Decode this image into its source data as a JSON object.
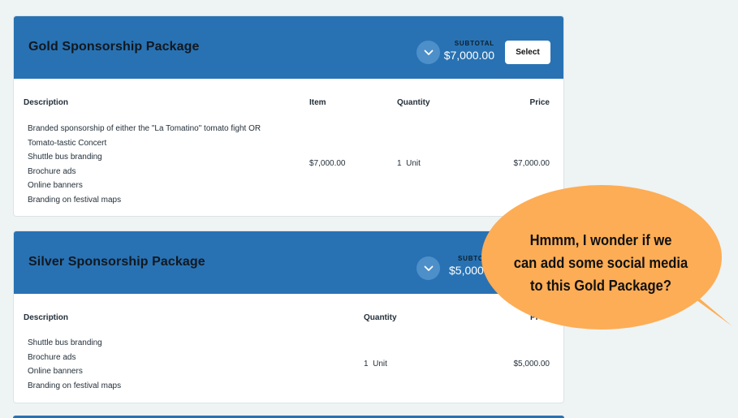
{
  "packages": [
    {
      "title": "Gold Sponsorship Package",
      "subtotal_label": "SUBTOTAL",
      "subtotal": "$7,000.00",
      "select_label": "Select",
      "headers": {
        "description": "Description",
        "item": "Item",
        "quantity": "Quantity",
        "price": "Price"
      },
      "lines": [
        "Branded sponsorship of either the \"La Tomatino\" tomato fight OR",
        "Tomato-tastic Concert",
        "Shuttle bus branding",
        "Brochure ads",
        "Online banners",
        "Branding on festival maps"
      ],
      "item": "$7,000.00",
      "quantity": "1  Unit",
      "price": "$7,000.00"
    },
    {
      "title": "Silver Sponsorship Package",
      "subtotal_label": "SUBTO",
      "subtotal": "$5,000.",
      "headers": {
        "description": "Description",
        "quantity": "Quantity",
        "price": "Pr"
      },
      "lines": [
        "Shuttle bus branding",
        "Brochure ads",
        "Online banners",
        "Branding on festival maps"
      ],
      "quantity": "1  Unit",
      "price": "$5,000.00"
    }
  ],
  "callout": {
    "line1": "Hmmm, I wonder if we",
    "line2": "can add some social media",
    "line3": "to this Gold Package?",
    "fill": "#fdad55"
  },
  "colors": {
    "header": "#2872b3",
    "page": "#eef3f4"
  }
}
